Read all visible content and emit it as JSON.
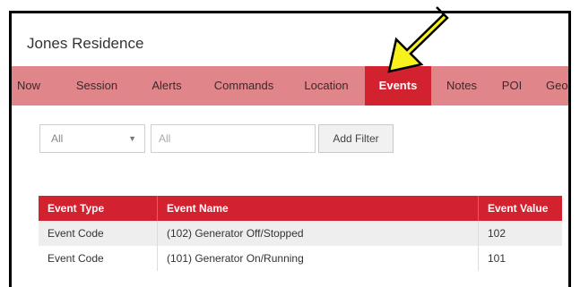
{
  "app": {
    "title": "Jones Residence"
  },
  "nav": {
    "items": [
      {
        "label": "Now"
      },
      {
        "label": "Session"
      },
      {
        "label": "Alerts"
      },
      {
        "label": "Commands"
      },
      {
        "label": "Location"
      },
      {
        "label": "Events"
      },
      {
        "label": "Notes"
      },
      {
        "label": "POI"
      },
      {
        "label": "Geo"
      }
    ],
    "active": "Events"
  },
  "filters": {
    "select_value": "All",
    "input_placeholder": "All",
    "add_label": "Add Filter"
  },
  "table": {
    "columns": [
      "Event Type",
      "Event Name",
      "Event Value"
    ],
    "rows": [
      [
        "Event Code",
        "(102) Generator Off/Stopped",
        "102"
      ],
      [
        "Event Code",
        "(101) Generator On/Running",
        "101"
      ]
    ]
  },
  "colors": {
    "nav_bg": "#e0858a",
    "accent": "#d22230",
    "arrow": "#f7f21d"
  }
}
